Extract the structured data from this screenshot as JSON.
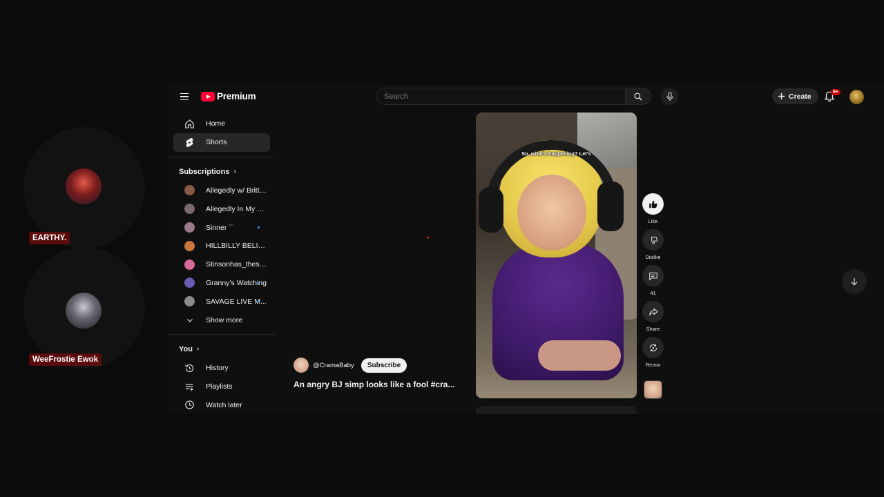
{
  "overlay": {
    "users": [
      {
        "name": "EARTHY."
      },
      {
        "name": "WeeFrostie Ewok"
      }
    ]
  },
  "header": {
    "logo_text": "Premium",
    "search_placeholder": "Search",
    "create_label": "Create",
    "notification_badge": "9+"
  },
  "sidebar": {
    "main": [
      {
        "label": "Home",
        "icon": "home-icon"
      },
      {
        "label": "Shorts",
        "icon": "shorts-icon",
        "active": true
      }
    ],
    "subscriptions_title": "Subscriptions",
    "subscriptions": [
      {
        "label": "Allegedly w/ Brittne...",
        "color": "#8a5a4a"
      },
      {
        "label": "Allegedly In My Opi...",
        "color": "#7a6a70"
      },
      {
        "label": "Sinner",
        "color": "#9a7a88",
        "badge": "²⁷⁰",
        "new": true
      },
      {
        "label": "HILLBILLY BELINDA",
        "color": "#c7763c"
      },
      {
        "label": "Stinsonhas_thesoup",
        "color": "#d86a9a"
      },
      {
        "label": "Granny's Watching",
        "color": "#6a5ab0",
        "new": true
      },
      {
        "label": "SAVAGE LIVE M...",
        "color": "#8a8a8a",
        "new": true
      }
    ],
    "show_more": "Show more",
    "you_title": "You",
    "you_items": [
      {
        "label": "History",
        "icon": "history-icon"
      },
      {
        "label": "Playlists",
        "icon": "playlists-icon"
      },
      {
        "label": "Watch later",
        "icon": "clock-icon"
      }
    ]
  },
  "short": {
    "caption": "So, what's happening? Let's",
    "channel": "@CramaBaby",
    "subscribe_label": "Subscribe",
    "title": "An angry BJ simp looks like a fool #cra...",
    "actions": {
      "like": "Like",
      "dislike": "Dislike",
      "comments": "41",
      "share": "Share",
      "remix": "Remix"
    }
  }
}
